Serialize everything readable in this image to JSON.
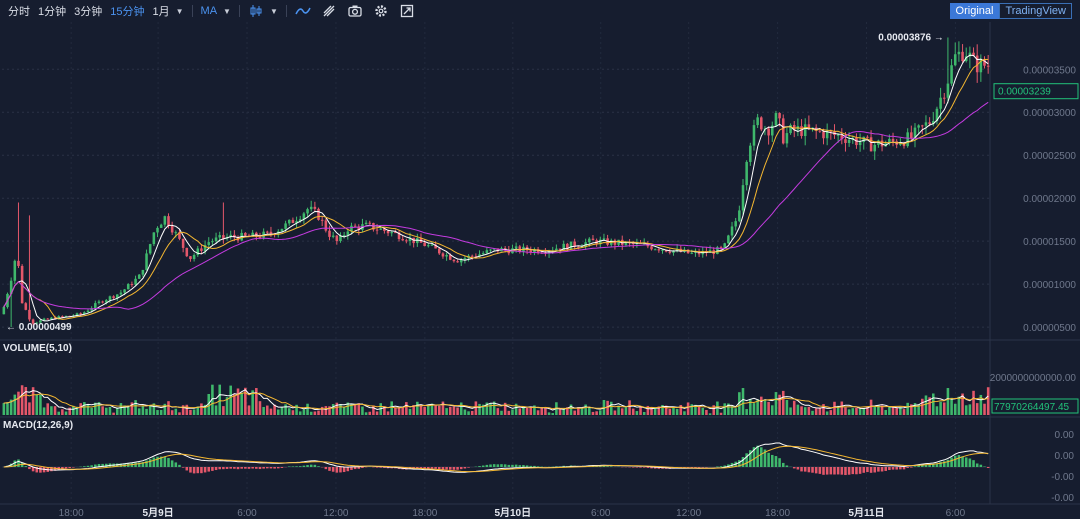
{
  "toolbar": {
    "timeframes": [
      "分时",
      "1分钟",
      "3分钟",
      "15分钟",
      "1月"
    ],
    "active_timeframe": "15分钟",
    "indicator": "MA",
    "icons": [
      "candle-style-icon",
      "line-style-icon",
      "draw-tool-icon",
      "camera-icon",
      "settings-icon",
      "fullscreen-icon"
    ],
    "views": [
      "Original",
      "TradingView"
    ],
    "active_view": "Original"
  },
  "chart_data": [
    {
      "type": "candlestick",
      "panel": "price",
      "yticks": [
        "0.00003500",
        "0.00003000",
        "0.00002500",
        "0.00002000",
        "0.00001500",
        "0.00001000",
        "0.00000500"
      ],
      "ylim": [
        3.5e-06,
        4.05e-05
      ],
      "high_label": "0.00003876",
      "low_label": "0.00000499",
      "last_price": "0.00003239",
      "last_price_color": "#22c27a",
      "up_color": "#3fb86c",
      "down_color": "#e4576a",
      "close_series": {
        "x": [
          0,
          0.01,
          0.015,
          0.02,
          0.03,
          0.05,
          0.08,
          0.1,
          0.12,
          0.14,
          0.155,
          0.165,
          0.175,
          0.19,
          0.2,
          0.21,
          0.23,
          0.25,
          0.27,
          0.29,
          0.31,
          0.32,
          0.33,
          0.34,
          0.35,
          0.37,
          0.4,
          0.43,
          0.46,
          0.5,
          0.55,
          0.6,
          0.65,
          0.7,
          0.73,
          0.745,
          0.755,
          0.765,
          0.775,
          0.785,
          0.79,
          0.8,
          0.82,
          0.85,
          0.88,
          0.9,
          0.92,
          0.94,
          0.955,
          0.965,
          0.975,
          0.985
        ],
        "y": [
          6.5e-06,
          1.1e-05,
          1.4e-05,
          8e-06,
          5.5e-06,
          6e-06,
          6.5e-06,
          8e-06,
          9e-06,
          1.1e-05,
          1.65e-05,
          1.78e-05,
          1.6e-05,
          1.3e-05,
          1.4e-05,
          1.5e-05,
          1.55e-05,
          1.55e-05,
          1.58e-05,
          1.7e-05,
          1.88e-05,
          1.8e-05,
          1.6e-05,
          1.48e-05,
          1.65e-05,
          1.68e-05,
          1.58e-05,
          1.45e-05,
          1.28e-05,
          1.4e-05,
          1.4e-05,
          1.5e-05,
          1.45e-05,
          1.35e-05,
          1.4e-05,
          1.8e-05,
          2.6e-05,
          2.9e-05,
          2.8e-05,
          2.95e-05,
          2.7e-05,
          2.8e-05,
          2.78e-05,
          2.72e-05,
          2.62e-05,
          2.65e-05,
          2.7e-05,
          2.9e-05,
          3.3e-05,
          3.65e-05,
          3.72e-05,
          3.55e-05
        ]
      },
      "ma_series": [
        {
          "color": "#ffffff"
        },
        {
          "color": "#f4b731"
        },
        {
          "color": "#c43be0"
        }
      ]
    },
    {
      "type": "bar",
      "panel": "volume",
      "label": "VOLUME(5,10)",
      "ytick": "2000000000000.00",
      "last_value": "77970264497.45",
      "last_value_color": "#22c27a"
    },
    {
      "type": "bar",
      "panel": "macd",
      "label": "MACD(12,26,9)",
      "yticks": [
        "0.00",
        "0.00",
        "-0.00",
        "-0.00"
      ]
    }
  ],
  "xaxis": {
    "ticks": [
      {
        "label": "18:00",
        "bold": false
      },
      {
        "label": "5月9日",
        "bold": true
      },
      {
        "label": "6:00",
        "bold": false
      },
      {
        "label": "12:00",
        "bold": false
      },
      {
        "label": "18:00",
        "bold": false
      },
      {
        "label": "5月10日",
        "bold": true
      },
      {
        "label": "6:00",
        "bold": false
      },
      {
        "label": "12:00",
        "bold": false
      },
      {
        "label": "18:00",
        "bold": false
      },
      {
        "label": "5月11日",
        "bold": true
      },
      {
        "label": "6:00",
        "bold": false
      }
    ]
  }
}
